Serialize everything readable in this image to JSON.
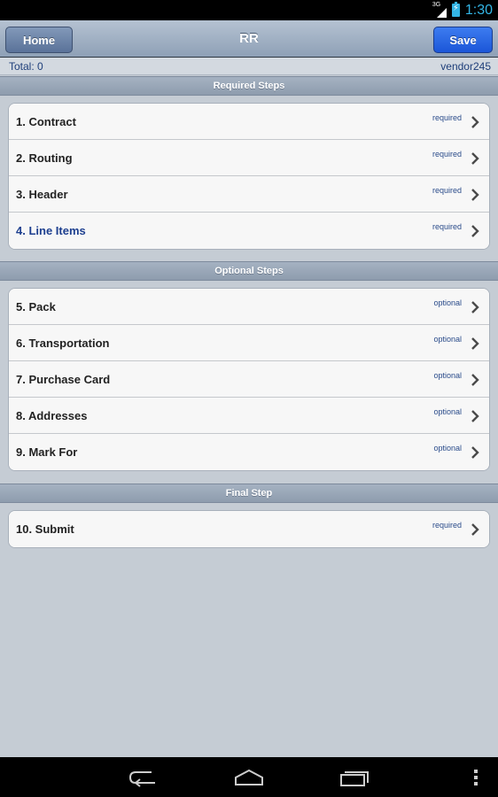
{
  "status_bar": {
    "network": "3G",
    "time": "1:30",
    "accent": "#33b5e5"
  },
  "toolbar": {
    "title": "RR",
    "home_label": "Home",
    "save_label": "Save"
  },
  "info": {
    "total": "Total: 0",
    "vendor": "vendor245"
  },
  "sections": {
    "required": {
      "header": "Required Steps",
      "items": [
        {
          "label": "1. Contract",
          "tag": "required"
        },
        {
          "label": "2. Routing",
          "tag": "required"
        },
        {
          "label": "3. Header",
          "tag": "required"
        },
        {
          "label": "4. Line Items",
          "tag": "required"
        }
      ]
    },
    "optional": {
      "header": "Optional Steps",
      "items": [
        {
          "label": "5. Pack",
          "tag": "optional"
        },
        {
          "label": "6. Transportation",
          "tag": "optional"
        },
        {
          "label": "7. Purchase Card",
          "tag": "optional"
        },
        {
          "label": "8. Addresses",
          "tag": "optional"
        },
        {
          "label": "9. Mark For",
          "tag": "optional"
        }
      ]
    },
    "final": {
      "header": "Final Step",
      "items": [
        {
          "label": "10. Submit",
          "tag": "required"
        }
      ]
    }
  },
  "nav_bar": {
    "icons": [
      "back-icon",
      "home-icon",
      "recent-apps-icon",
      "menu-icon"
    ]
  }
}
